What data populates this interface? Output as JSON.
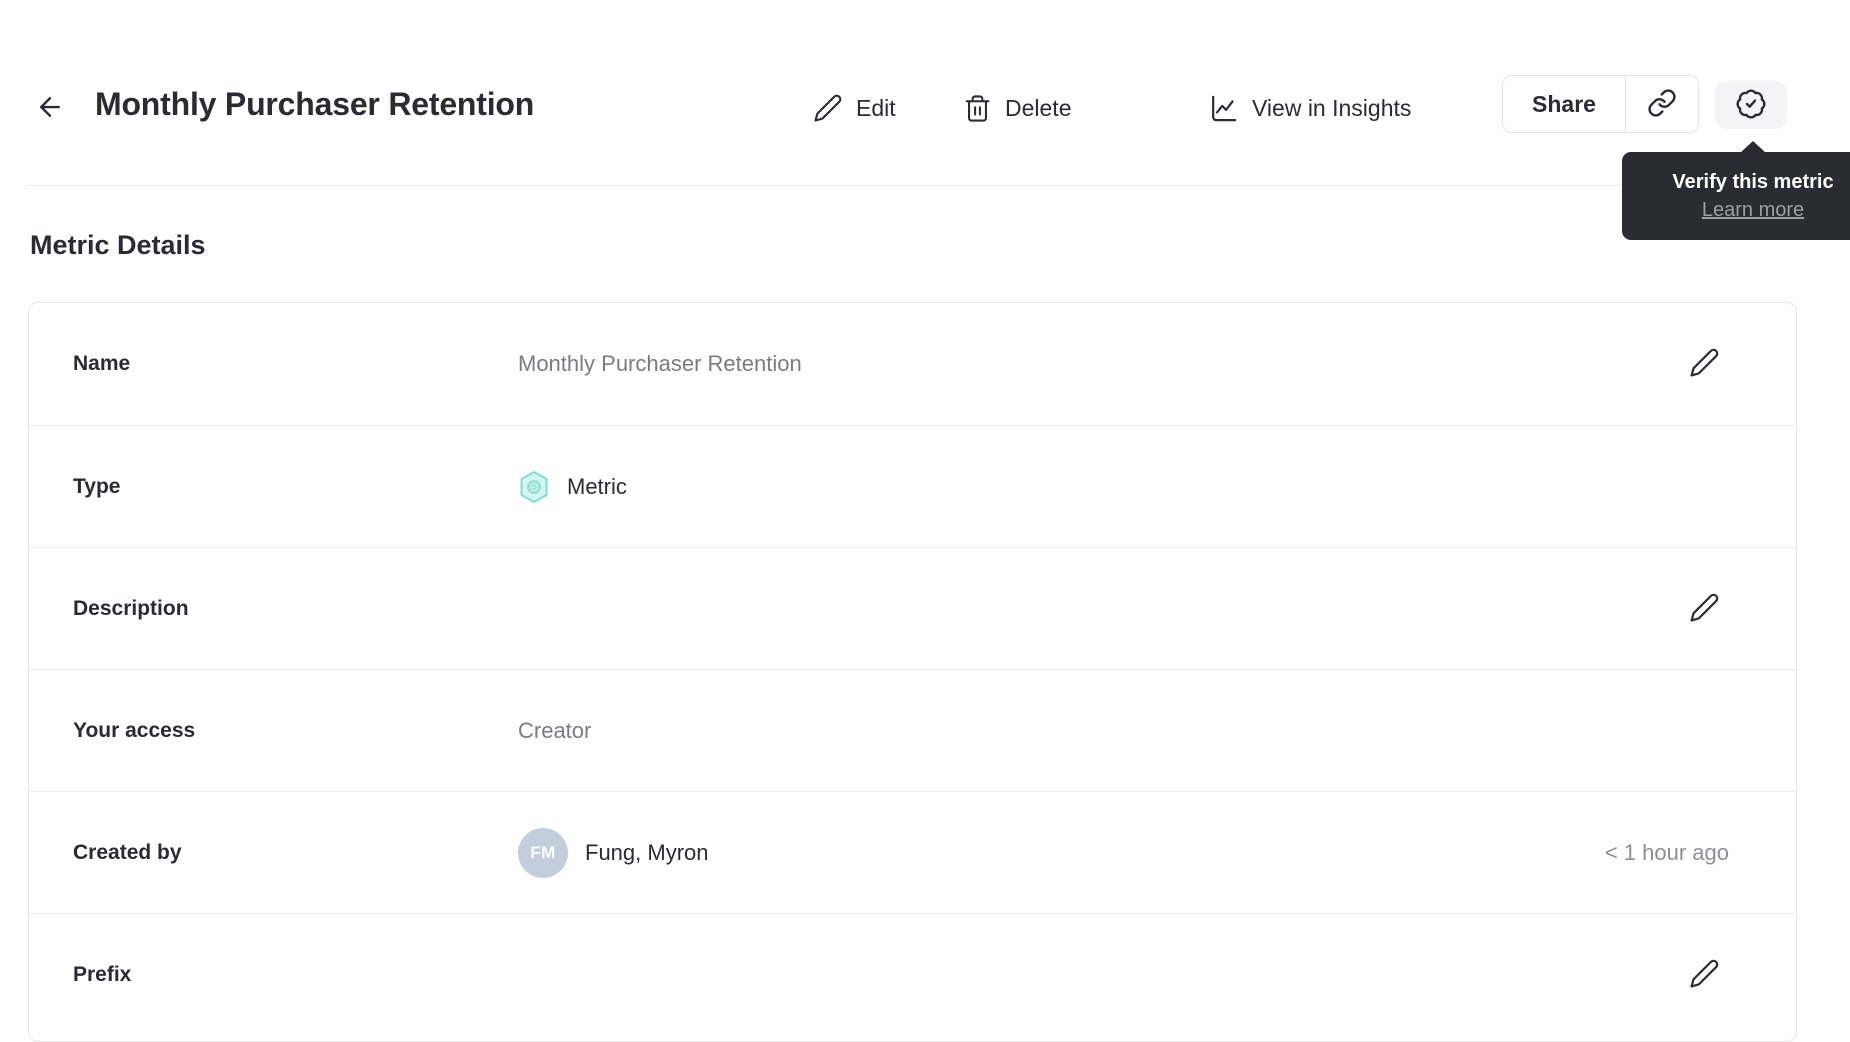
{
  "header": {
    "title": "Monthly Purchaser Retention",
    "actions": {
      "edit": "Edit",
      "delete": "Delete",
      "view_in_insights": "View in Insights",
      "share": "Share"
    }
  },
  "tooltip": {
    "title": "Verify this metric",
    "link": "Learn more"
  },
  "section": {
    "title": "Metric Details"
  },
  "details": {
    "rows": [
      {
        "label": "Name",
        "value": "Monthly Purchaser Retention",
        "editable": true
      },
      {
        "label": "Type",
        "value": "Metric",
        "icon": "metric-hexagon-icon"
      },
      {
        "label": "Description",
        "value": "",
        "editable": true
      },
      {
        "label": "Your access",
        "value": "Creator"
      },
      {
        "label": "Created by",
        "value": "Fung, Myron",
        "avatar_initials": "FM",
        "timestamp": "< 1 hour ago"
      },
      {
        "label": "Prefix",
        "value": "",
        "editable": true
      }
    ]
  },
  "colors": {
    "text_dark": "#2b2b33",
    "text_gray": "#7b7b81",
    "accent_teal_border": "#7ce0d3",
    "accent_teal_fill": "#d7f5ef",
    "tooltip_bg": "#2b2b33",
    "avatar_bg": "#c3cedd",
    "divider": "#ececee"
  }
}
